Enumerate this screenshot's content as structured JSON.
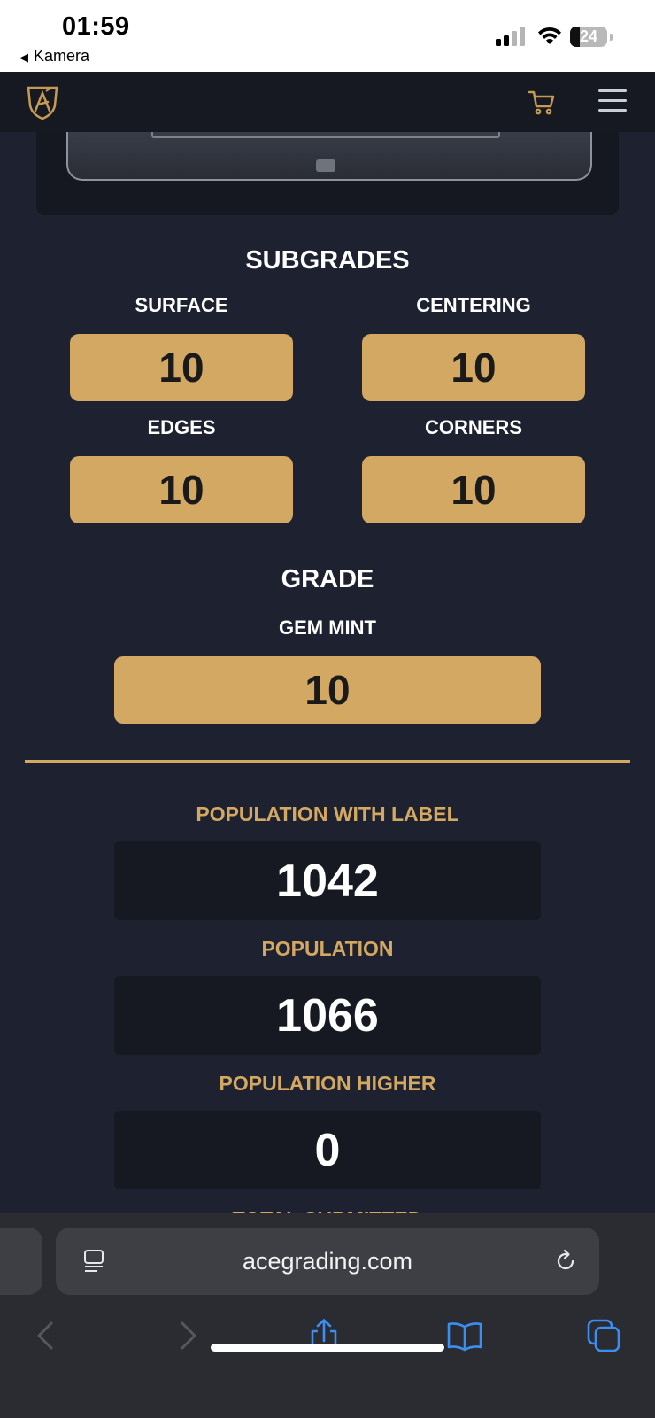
{
  "status": {
    "time": "01:59",
    "back_label": "Kamera",
    "battery": "24"
  },
  "header": {
    "logo": "ace-shield-logo",
    "cart_icon": "cart-icon",
    "menu_icon": "hamburger-menu-icon"
  },
  "subgrades": {
    "title": "SUBGRADES",
    "items": [
      {
        "label": "SURFACE",
        "value": "10"
      },
      {
        "label": "CENTERING",
        "value": "10"
      },
      {
        "label": "EDGES",
        "value": "10"
      },
      {
        "label": "CORNERS",
        "value": "10"
      }
    ]
  },
  "grade": {
    "title": "GRADE",
    "label": "GEM MINT",
    "value": "10"
  },
  "population": {
    "items": [
      {
        "label": "POPULATION WITH LABEL",
        "value": "1042"
      },
      {
        "label": "POPULATION",
        "value": "1066"
      },
      {
        "label": "POPULATION HIGHER",
        "value": "0"
      }
    ],
    "next_label_partial": "TOTAL SUBMITTED"
  },
  "browser": {
    "url": "acegrading.com"
  },
  "colors": {
    "accent": "#d3a862",
    "background": "#1e2230",
    "panel": "#161922"
  }
}
